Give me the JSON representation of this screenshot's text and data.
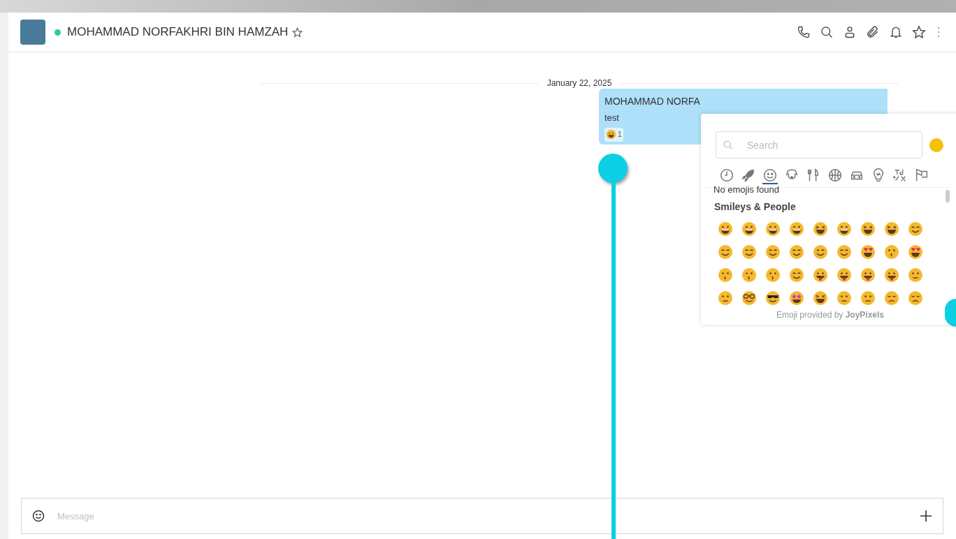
{
  "header": {
    "contact_name": "MOHAMMAD NORFAKHRI BIN HAMZAH",
    "online": true,
    "favorite": false,
    "actions": [
      {
        "kind": "phone"
      },
      {
        "kind": "search"
      },
      {
        "kind": "user"
      },
      {
        "kind": "attach"
      },
      {
        "kind": "bell"
      },
      {
        "kind": "star"
      },
      {
        "kind": "more"
      }
    ]
  },
  "date_divider": "January 22, 2025",
  "message": {
    "sender": "MOHAMMAD NORFA",
    "text": "test",
    "reaction": {
      "count": "1"
    }
  },
  "emoji_picker": {
    "search_placeholder": "Search",
    "categories": [
      {
        "kind": "clock",
        "selected": false
      },
      {
        "kind": "rocket",
        "selected": false
      },
      {
        "kind": "smiley",
        "selected": true
      },
      {
        "kind": "dog",
        "selected": false
      },
      {
        "kind": "food",
        "selected": false
      },
      {
        "kind": "ball",
        "selected": false
      },
      {
        "kind": "car",
        "selected": false
      },
      {
        "kind": "bulb",
        "selected": false
      },
      {
        "kind": "symbols",
        "selected": false
      },
      {
        "kind": "flag",
        "selected": false
      }
    ],
    "empty_notice": "No emojis found",
    "section_title": "Smileys & People",
    "emojis": [
      {
        "kind": "grin"
      },
      {
        "kind": "grin"
      },
      {
        "kind": "grin"
      },
      {
        "kind": "grin"
      },
      {
        "kind": "laugh"
      },
      {
        "kind": "grin"
      },
      {
        "kind": "laugh"
      },
      {
        "kind": "laugh"
      },
      {
        "kind": "smile"
      },
      {
        "kind": "smile"
      },
      {
        "kind": "smile"
      },
      {
        "kind": "smile"
      },
      {
        "kind": "smile"
      },
      {
        "kind": "wink"
      },
      {
        "kind": "smile"
      },
      {
        "kind": "hearts"
      },
      {
        "kind": "kiss"
      },
      {
        "kind": "hearts"
      },
      {
        "kind": "kiss"
      },
      {
        "kind": "kiss"
      },
      {
        "kind": "kiss"
      },
      {
        "kind": "smile"
      },
      {
        "kind": "tongue"
      },
      {
        "kind": "tongue"
      },
      {
        "kind": "tongue"
      },
      {
        "kind": "tongue"
      },
      {
        "kind": "neutral"
      },
      {
        "kind": "neutral"
      },
      {
        "kind": "glasses"
      },
      {
        "kind": "sunglasses"
      },
      {
        "kind": "stars"
      },
      {
        "kind": "laugh"
      },
      {
        "kind": "neutral"
      },
      {
        "kind": "neutral"
      },
      {
        "kind": "sad"
      },
      {
        "kind": "sad"
      }
    ],
    "footer": "Emoji provided by **JoyPixels**"
  },
  "composer": {
    "placeholder": "Message"
  }
}
